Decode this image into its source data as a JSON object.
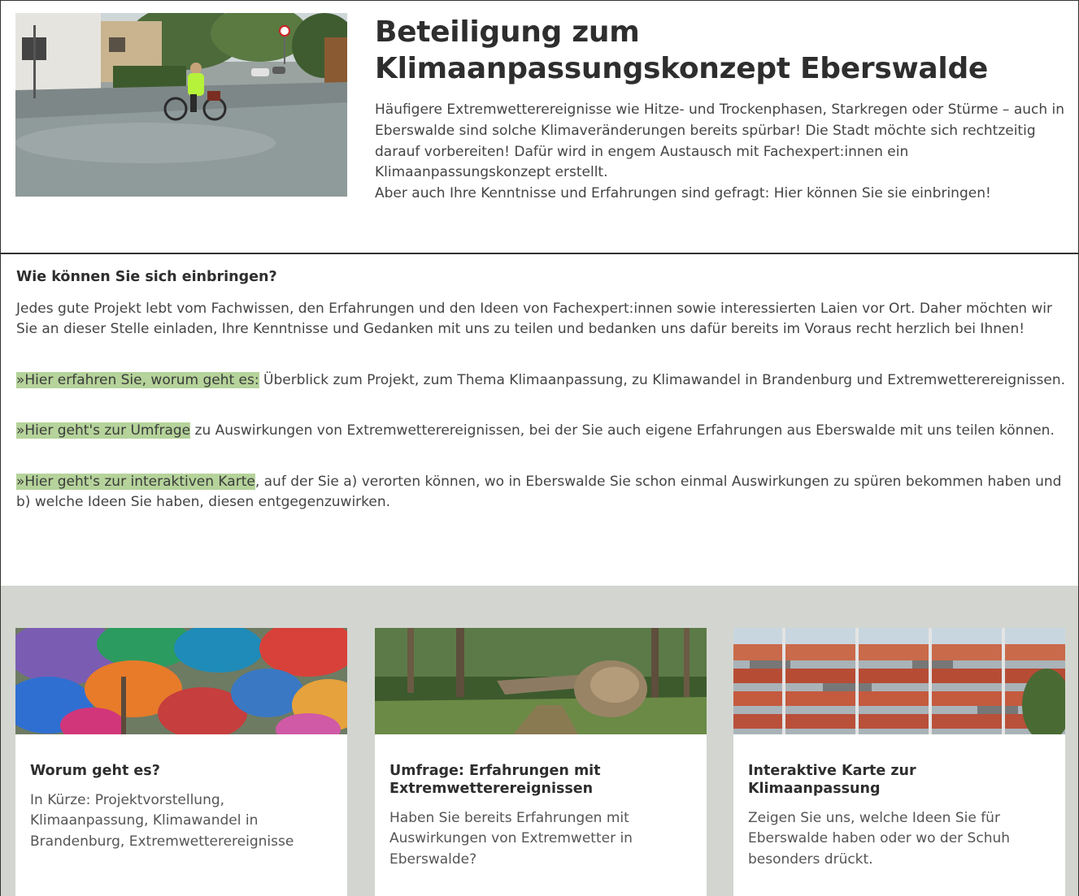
{
  "hero": {
    "title_line1": "Beteiligung zum",
    "title_line2": "Klimaanpassungskonzept Eberswalde",
    "paragraph1": "Häufigere Extremwetterereignisse wie Hitze- und Trockenphasen, Starkregen oder Stürme – auch in Eberswalde sind solche Klimaveränderungen bereits spürbar! Die Stadt möchte sich rechtzeitig darauf vorbereiten! Dafür wird in engem Austausch mit Fachexpert:innen ein Klimaanpassungskonzept erstellt.",
    "paragraph2": "Aber auch Ihre Kenntnisse und Erfahrungen sind gefragt: Hier können Sie sie einbringen!"
  },
  "info": {
    "heading": "Wie können Sie sich einbringen?",
    "intro": "Jedes gute Projekt lebt vom Fachwissen, den Erfahrungen und den Ideen von Fachexpert:innen sowie interessierten Laien vor Ort. Daher möchten wir Sie an dieser Stelle einladen, Ihre Kenntnisse und Gedanken mit uns zu teilen und bedanken uns dafür bereits im Voraus recht herzlich bei Ihnen!",
    "items": [
      {
        "link": "»Hier erfahren Sie, worum geht es:",
        "text": " Überblick zum Projekt, zum Thema Klimaanpassung, zu Klimawandel in Brandenburg und Extremwetterereignissen."
      },
      {
        "link": "»Hier geht's zur Umfrage",
        "text": " zu Auswirkungen von Extremwetterereignissen, bei der Sie auch eigene Erfahrungen aus Eberswalde mit uns teilen können."
      },
      {
        "link": "»Hier geht's zur interaktiven Karte",
        "text": ", auf der Sie a) verorten können, wo in Eberswalde Sie schon einmal Auswirkungen zu spüren bekommen haben und b) welche Ideen Sie haben, diesen entgegenzuwirken."
      }
    ]
  },
  "cards": [
    {
      "title": "Worum geht es?",
      "desc": "In Kürze: Projektvorstellung, Klimaanpassung, Klimawandel in Brandenburg, Extremwetterereignisse"
    },
    {
      "title": "Umfrage: Erfahrungen mit Extremwetterereignissen",
      "desc": "Haben Sie bereits Erfahrungen mit Auswirkungen von Extremwetter in Eberswalde?"
    },
    {
      "title": "Interaktive Karte zur Klimaanpassung",
      "desc": "Zeigen Sie uns, welche Ideen Sie für Eberswalde haben oder wo der Schuh besonders drückt."
    }
  ],
  "colors": {
    "highlight": "#b5d39a",
    "cards_background": "#d3d6d0"
  }
}
